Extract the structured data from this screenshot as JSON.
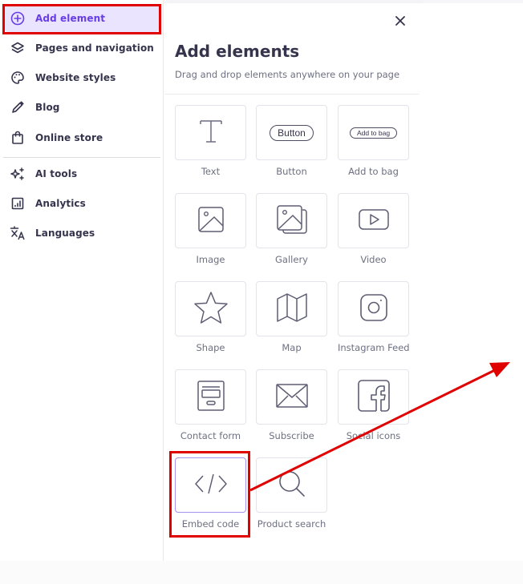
{
  "sidebar": {
    "items": [
      {
        "label": "Add element",
        "icon": "plus-circle-icon",
        "active": true
      },
      {
        "label": "Pages and navigation",
        "icon": "layers-icon"
      },
      {
        "label": "Website styles",
        "icon": "palette-icon"
      },
      {
        "label": "Blog",
        "icon": "pencil-icon"
      },
      {
        "label": "Online store",
        "icon": "shopping-bag-icon"
      },
      {
        "label": "AI tools",
        "icon": "sparkles-icon"
      },
      {
        "label": "Analytics",
        "icon": "chart-icon"
      },
      {
        "label": "Languages",
        "icon": "translate-icon"
      }
    ]
  },
  "panel": {
    "title": "Add elements",
    "subtitle": "Drag and drop elements anywhere on your page",
    "close_icon": "close-icon",
    "tiles": [
      {
        "label": "Text",
        "icon": "text-icon"
      },
      {
        "label": "Button",
        "icon": "button-icon",
        "preview": "Button"
      },
      {
        "label": "Add to bag",
        "icon": "add-to-bag-icon",
        "preview": "Add to bag"
      },
      {
        "label": "Image",
        "icon": "image-icon"
      },
      {
        "label": "Gallery",
        "icon": "gallery-icon"
      },
      {
        "label": "Video",
        "icon": "video-icon"
      },
      {
        "label": "Shape",
        "icon": "star-icon"
      },
      {
        "label": "Map",
        "icon": "map-icon"
      },
      {
        "label": "Instagram Feed",
        "icon": "instagram-icon"
      },
      {
        "label": "Contact form",
        "icon": "contact-form-icon"
      },
      {
        "label": "Subscribe",
        "icon": "envelope-icon"
      },
      {
        "label": "Social icons",
        "icon": "facebook-icon"
      },
      {
        "label": "Embed code",
        "icon": "code-icon",
        "selected": true
      },
      {
        "label": "Product search",
        "icon": "search-icon"
      }
    ]
  },
  "annotations": {
    "highlight_color": "#e00000",
    "accent_color": "#673de6"
  }
}
